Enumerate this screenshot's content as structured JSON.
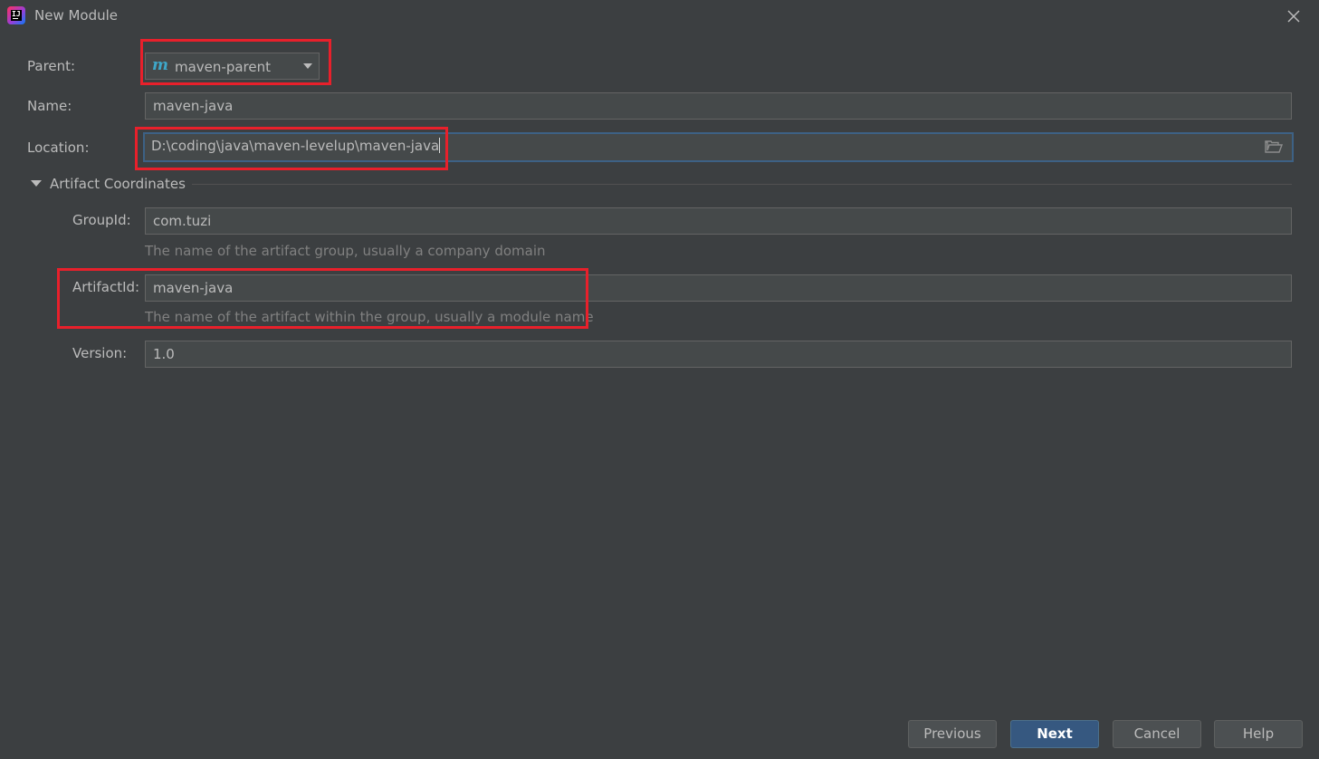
{
  "window": {
    "title": "New Module"
  },
  "form": {
    "parent": {
      "label": "Parent:",
      "value": "maven-parent",
      "icon_glyph": "m"
    },
    "name": {
      "label": "Name:",
      "value": "maven-java"
    },
    "location": {
      "label": "Location:",
      "value": "D:\\coding\\java\\maven-levelup\\maven-java"
    }
  },
  "artifact_section": {
    "title": "Artifact Coordinates",
    "expanded": true,
    "group_id": {
      "label": "GroupId:",
      "value": "com.tuzi",
      "hint": "The name of the artifact group, usually a company domain"
    },
    "artifact_id": {
      "label": "ArtifactId:",
      "value": "maven-java",
      "hint": "The name of the artifact within the group, usually a module name"
    },
    "version": {
      "label": "Version:",
      "value": "1.0"
    }
  },
  "buttons": {
    "previous": "Previous",
    "next": "Next",
    "cancel": "Cancel",
    "help": "Help"
  },
  "colors": {
    "background": "#3c3f41",
    "field_background": "#45494a",
    "focus_border": "#3d6185",
    "annotation": "#e8202b",
    "primary_button": "#365880",
    "maven_icon": "#3ea7c9"
  }
}
